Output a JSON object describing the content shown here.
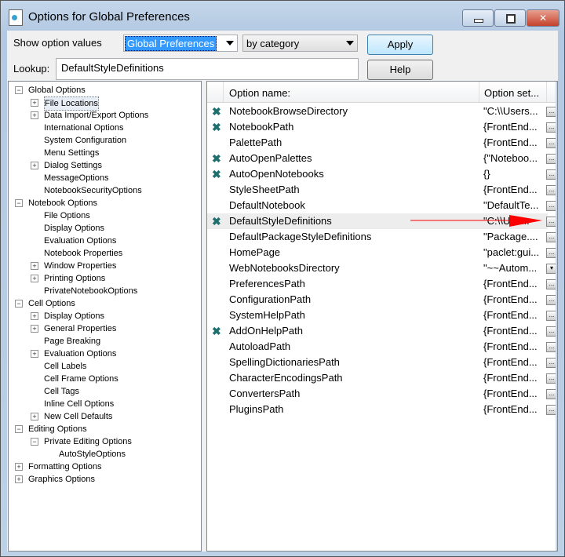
{
  "window": {
    "title": "Options for Global Preferences",
    "minimize": "minimize",
    "maximize": "maximize",
    "close": "close"
  },
  "controls": {
    "show_label": "Show option values",
    "scope_value": "Global Preferences",
    "view_value": "by category",
    "apply": "Apply",
    "help": "Help",
    "lookup_label": "Lookup:",
    "lookup_value": "DefaultStyleDefinitions"
  },
  "tree": [
    {
      "label": "Global Options",
      "level": 0,
      "exp": "-"
    },
    {
      "label": "File Locations",
      "level": 1,
      "exp": "+",
      "selected": true
    },
    {
      "label": "Data Import/Export Options",
      "level": 1,
      "exp": "+"
    },
    {
      "label": "International Options",
      "level": 1,
      "exp": ""
    },
    {
      "label": "System Configuration",
      "level": 1,
      "exp": ""
    },
    {
      "label": "Menu Settings",
      "level": 1,
      "exp": ""
    },
    {
      "label": "Dialog Settings",
      "level": 1,
      "exp": "+"
    },
    {
      "label": "MessageOptions",
      "level": 1,
      "exp": ""
    },
    {
      "label": "NotebookSecurityOptions",
      "level": 1,
      "exp": ""
    },
    {
      "label": "Notebook Options",
      "level": 0,
      "exp": "-"
    },
    {
      "label": "File Options",
      "level": 1,
      "exp": ""
    },
    {
      "label": "Display Options",
      "level": 1,
      "exp": ""
    },
    {
      "label": "Evaluation Options",
      "level": 1,
      "exp": ""
    },
    {
      "label": "Notebook Properties",
      "level": 1,
      "exp": ""
    },
    {
      "label": "Window Properties",
      "level": 1,
      "exp": "+"
    },
    {
      "label": "Printing Options",
      "level": 1,
      "exp": "+"
    },
    {
      "label": "PrivateNotebookOptions",
      "level": 1,
      "exp": ""
    },
    {
      "label": "Cell Options",
      "level": 0,
      "exp": "-"
    },
    {
      "label": "Display Options",
      "level": 1,
      "exp": "+"
    },
    {
      "label": "General Properties",
      "level": 1,
      "exp": "+"
    },
    {
      "label": "Page Breaking",
      "level": 1,
      "exp": ""
    },
    {
      "label": "Evaluation Options",
      "level": 1,
      "exp": "+"
    },
    {
      "label": "Cell Labels",
      "level": 1,
      "exp": ""
    },
    {
      "label": "Cell Frame Options",
      "level": 1,
      "exp": ""
    },
    {
      "label": "Cell Tags",
      "level": 1,
      "exp": ""
    },
    {
      "label": "Inline Cell Options",
      "level": 1,
      "exp": ""
    },
    {
      "label": "New Cell Defaults",
      "level": 1,
      "exp": "+"
    },
    {
      "label": "Editing Options",
      "level": 0,
      "exp": "-"
    },
    {
      "label": "Private Editing Options",
      "level": 1,
      "exp": "-"
    },
    {
      "label": "AutoStyleOptions",
      "level": 2,
      "exp": ""
    },
    {
      "label": "Formatting Options",
      "level": 0,
      "exp": "+"
    },
    {
      "label": "Graphics Options",
      "level": 0,
      "exp": "+"
    }
  ],
  "table": {
    "col_name": "Option name:",
    "col_setting": "Option set...",
    "rows": [
      {
        "name": "NotebookBrowseDirectory",
        "value": "\"C:\\\\Users...",
        "set": true,
        "btn": "..."
      },
      {
        "name": "NotebookPath",
        "value": "{FrontEnd...",
        "set": true,
        "btn": "..."
      },
      {
        "name": "PalettePath",
        "value": "{FrontEnd...",
        "set": false,
        "btn": "..."
      },
      {
        "name": "AutoOpenPalettes",
        "value": "{\"Noteboo...",
        "set": true,
        "btn": "..."
      },
      {
        "name": "AutoOpenNotebooks",
        "value": "{}",
        "set": true,
        "btn": "..."
      },
      {
        "name": "StyleSheetPath",
        "value": "{FrontEnd...",
        "set": false,
        "btn": "..."
      },
      {
        "name": "DefaultNotebook",
        "value": "\"DefaultTe...",
        "set": false,
        "btn": "..."
      },
      {
        "name": "DefaultStyleDefinitions",
        "value": "\"C:\\\\Use...",
        "set": true,
        "btn": "...",
        "highlight": true
      },
      {
        "name": "DefaultPackageStyleDefinitions",
        "value": "\"Package....",
        "set": false,
        "btn": "..."
      },
      {
        "name": "HomePage",
        "value": "\"paclet:gui...",
        "set": false,
        "btn": "..."
      },
      {
        "name": "WebNotebooksDirectory",
        "value": "\"~~Autom...",
        "set": false,
        "btn": "▾"
      },
      {
        "name": "PreferencesPath",
        "value": "{FrontEnd...",
        "set": false,
        "btn": "..."
      },
      {
        "name": "ConfigurationPath",
        "value": "{FrontEnd...",
        "set": false,
        "btn": "..."
      },
      {
        "name": "SystemHelpPath",
        "value": "{FrontEnd...",
        "set": false,
        "btn": "..."
      },
      {
        "name": "AddOnHelpPath",
        "value": "{FrontEnd...",
        "set": true,
        "btn": "..."
      },
      {
        "name": "AutoloadPath",
        "value": "{FrontEnd...",
        "set": false,
        "btn": "..."
      },
      {
        "name": "SpellingDictionariesPath",
        "value": "{FrontEnd...",
        "set": false,
        "btn": "..."
      },
      {
        "name": "CharacterEncodingsPath",
        "value": "{FrontEnd...",
        "set": false,
        "btn": "..."
      },
      {
        "name": "ConvertersPath",
        "value": "{FrontEnd...",
        "set": false,
        "btn": "..."
      },
      {
        "name": "PluginsPath",
        "value": "{FrontEnd...",
        "set": false,
        "btn": "..."
      }
    ]
  },
  "colors": {
    "selection": "#3399ff",
    "set_marker": "#1f6f6f",
    "annotation_arrow": "#ff0000"
  }
}
